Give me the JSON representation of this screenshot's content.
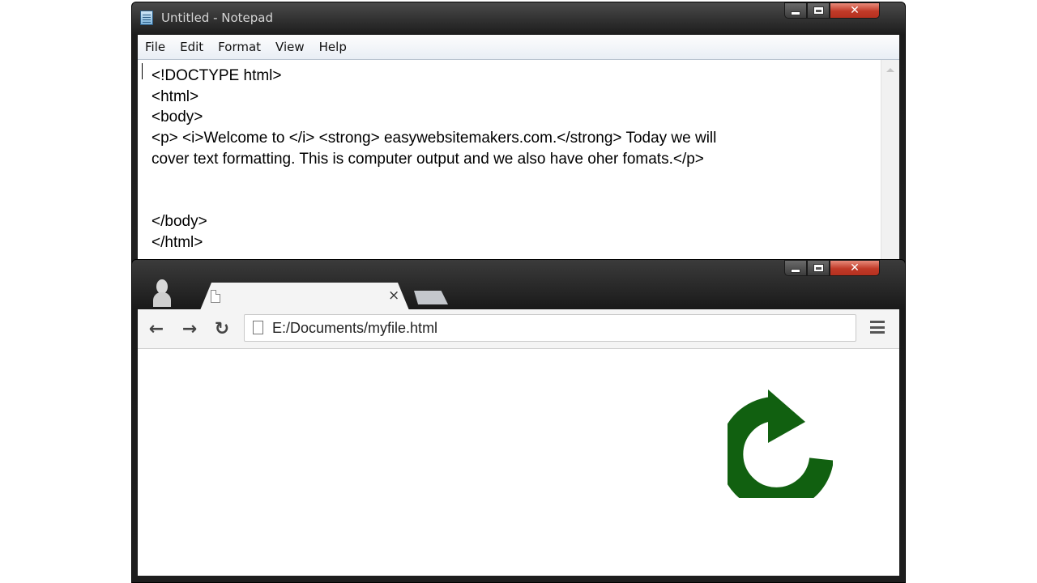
{
  "notepad": {
    "title": "Untitled - Notepad",
    "menu": [
      "File",
      "Edit",
      "Format",
      "View",
      "Help"
    ],
    "content": "<!DOCTYPE html>\n<html>\n<body>\n<p> <i>Welcome to </i> <strong> easywebsitemakers.com.</strong> Today we will\ncover text formatting. This is computer output and we also have oher fomats.</p>\n\n\n</body>\n</html>",
    "close_glyph": "✕"
  },
  "browser": {
    "tab_close_glyph": "×",
    "back_glyph": "←",
    "forward_glyph": "→",
    "reload_glyph": "↻",
    "url": "E:/Documents/myfile.html",
    "close_glyph": "✕",
    "overlay_icon": "reload-arrow-icon",
    "overlay_color": "#116010"
  }
}
